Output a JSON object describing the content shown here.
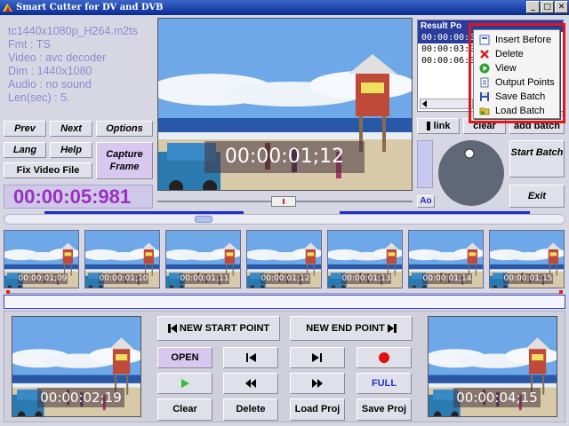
{
  "window": {
    "title": "Smart Cutter for DV and DVB",
    "min_label": "_",
    "max_label": "□",
    "close_label": "✕"
  },
  "info": {
    "filename": "tc1440x1080p_H264.m2ts",
    "fmt": "Fmt : TS",
    "video": "Video : avc decoder",
    "dim": "Dim : 1440x1080",
    "audio": "Audio : no sound",
    "len": "Len(sec) : 5."
  },
  "buttons": {
    "prev": "Prev",
    "next": "Next",
    "options": "Options",
    "lang": "Lang",
    "help": "Help",
    "capture_frame": "Capture Frame",
    "fix_video_file": "Fix Video File",
    "link": "link",
    "clear_top": "clear",
    "add_batch": "add batch",
    "start_batch": "Start Batch",
    "exit": "Exit",
    "ao": "Ao"
  },
  "timer": "00:00:05:981",
  "main_video": {
    "timecode": "00:00:01;12"
  },
  "result": {
    "header": "Result Po",
    "rows": [
      "00:00:00:0",
      "00:00:03:0",
      "00:00:06:0"
    ]
  },
  "context_menu": {
    "items": [
      {
        "label": "Insert Before",
        "icon": "insert-icon"
      },
      {
        "label": "Delete",
        "icon": "delete-x-icon"
      },
      {
        "label": "View",
        "icon": "play-icon"
      },
      {
        "label": "Output Points",
        "icon": "document-icon"
      },
      {
        "label": "Save Batch",
        "icon": "floppy-icon"
      },
      {
        "label": "Load Batch",
        "icon": "folder-icon"
      }
    ]
  },
  "thumbnails": [
    {
      "timecode": "00:00:01;09"
    },
    {
      "timecode": "00:00:01;10"
    },
    {
      "timecode": "00:00:01;11"
    },
    {
      "timecode": "00:00:01;12"
    },
    {
      "timecode": "00:00:01;13"
    },
    {
      "timecode": "00:00:01;14"
    },
    {
      "timecode": "00:00:01;15"
    }
  ],
  "bottom": {
    "start_timecode": "00:00:02;19",
    "end_timecode": "00:00:04;15",
    "new_start_point": "NEW START POINT",
    "new_end_point": "NEW END POINT",
    "open": "OPEN",
    "full": "FULL",
    "clear": "Clear",
    "delete": "Delete",
    "load_proj": "Load Proj",
    "save_proj": "Save Proj"
  },
  "colors": {
    "accent_blue": "#2a3c9c",
    "timer_purple": "#9a30c0",
    "info_text": "#8b8bd0",
    "highlight_red": "#e0161a"
  }
}
